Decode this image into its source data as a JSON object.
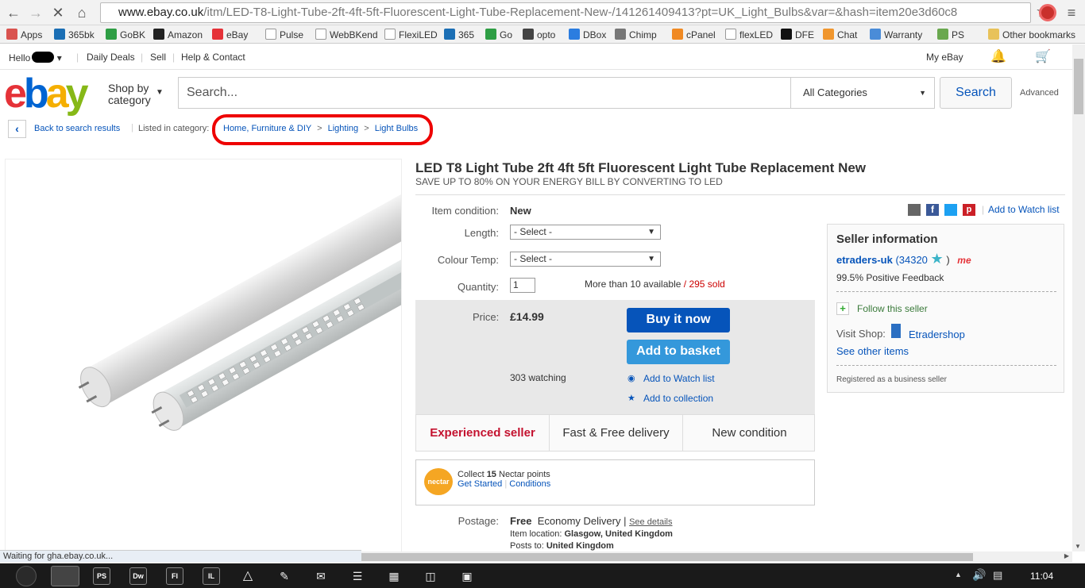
{
  "browser": {
    "url_domain": "www.ebay.co.uk",
    "url_path": "/itm/LED-T8-Light-Tube-2ft-4ft-5ft-Fluorescent-Light-Tube-Replacement-New-/141261409413?pt=UK_Light_Bulbs&var=&hash=item20e3d60c8",
    "bookmarks": [
      {
        "label": "Apps",
        "color": "#d9534f"
      },
      {
        "label": "365bk",
        "color": "#1b6fb5"
      },
      {
        "label": "GoBK",
        "color": "#2e9e44"
      },
      {
        "label": "Amazon",
        "color": "#222222"
      },
      {
        "label": "eBay",
        "color": "#e53238"
      },
      {
        "label": "Pulse",
        "color": "#dddddd"
      },
      {
        "label": "WebBKend",
        "color": "#dddddd"
      },
      {
        "label": "FlexiLED",
        "color": "#dddddd"
      },
      {
        "label": "365",
        "color": "#1b6fb5"
      },
      {
        "label": "Go",
        "color": "#2e9e44"
      },
      {
        "label": "opto",
        "color": "#444444"
      },
      {
        "label": "DBox",
        "color": "#2b7de0"
      },
      {
        "label": "Chimp",
        "color": "#777777"
      },
      {
        "label": "cPanel",
        "color": "#f08a24"
      },
      {
        "label": "flexLED",
        "color": "#dddddd"
      },
      {
        "label": "DFE",
        "color": "#111111"
      },
      {
        "label": "Chat",
        "color": "#f0962e"
      },
      {
        "label": "Warranty",
        "color": "#4a8cd8"
      },
      {
        "label": "PS",
        "color": "#6aa84f"
      }
    ],
    "other_bookmarks": "Other bookmarks",
    "status_text": "Waiting for gha.ebay.co.uk..."
  },
  "topnav": {
    "hello": "Hello",
    "daily_deals": "Daily Deals",
    "sell": "Sell",
    "help": "Help & Contact",
    "my_ebay": "My eBay"
  },
  "header": {
    "shop_by": "Shop by",
    "category": "category",
    "search_placeholder": "Search...",
    "all_categories": "All Categories",
    "search_button": "Search",
    "advanced": "Advanced"
  },
  "breadcrumb": {
    "back": "Back to search results",
    "listed_in": "Listed in category:",
    "items": [
      "Home, Furniture & DIY",
      "Lighting",
      "Light Bulbs"
    ]
  },
  "item": {
    "title": "LED T8 Light Tube 2ft 4ft 5ft Fluorescent Light Tube Replacement New",
    "subtitle": "SAVE UP TO 80% ON YOUR ENERGY BILL BY CONVERTING TO LED",
    "condition_label": "Item condition:",
    "condition_value": "New",
    "length_label": "Length:",
    "length_value": "- Select -",
    "colour_label": "Colour Temp:",
    "colour_value": "- Select -",
    "quantity_label": "Quantity:",
    "quantity_value": "1",
    "available": "More than 10 available",
    "sold": "295 sold",
    "price_label": "Price:",
    "price": "£14.99",
    "buy_now": "Buy it now",
    "add_basket": "Add to basket",
    "watching": "303 watching",
    "add_watch": "Add to Watch list",
    "add_collection": "Add to collection",
    "watch_list_top": "Add to Watch list",
    "badges": [
      "Experienced seller",
      "Fast & Free delivery",
      "New condition"
    ],
    "nectar_collect": "Collect",
    "nectar_points": "15",
    "nectar_text": "Nectar points",
    "nectar_start": "Get Started",
    "nectar_conditions": "Conditions",
    "nectar_logo": "nectar",
    "postage_label": "Postage:",
    "postage_free": "Free",
    "postage_type": "Economy Delivery",
    "see_details": "See details",
    "item_location_label": "Item location:",
    "item_location": "Glasgow, United Kingdom",
    "posts_to_label": "Posts to:",
    "posts_to": "United Kingdom"
  },
  "seller": {
    "heading": "Seller information",
    "name": "etraders-uk",
    "score": "(34320",
    "score_close": ")",
    "me": "me",
    "feedback": "99.5% Positive Feedback",
    "follow": "Follow this seller",
    "visit_shop": "Visit Shop:",
    "shop_name": "Etradershop",
    "other_items": "See other items",
    "registered": "Registered as a business seller"
  },
  "taskbar": {
    "time": "11:04",
    "apps": [
      "PS",
      "Dw",
      "Fl",
      "IL"
    ]
  }
}
